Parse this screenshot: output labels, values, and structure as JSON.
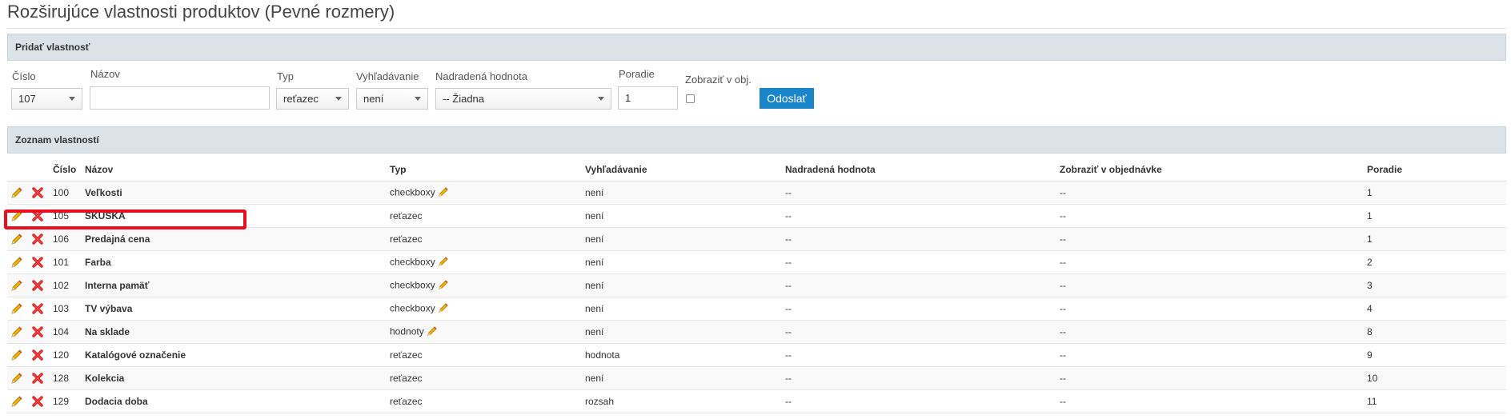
{
  "page": {
    "title": "Rozširujúce vlastnosti produktov (Pevné rozmery)"
  },
  "add_panel": {
    "heading": "Pridať vlastnosť",
    "labels": {
      "cislo": "Číslo",
      "nazov": "Názov",
      "typ": "Typ",
      "vyhladavanie": "Vyhľadávanie",
      "nadradena": "Nadradená hodnota",
      "poradie": "Poradie",
      "zobrazit": "Zobraziť v obj."
    },
    "values": {
      "cislo": "107",
      "nazov": "",
      "typ": "reťazec",
      "vyhladavanie": "není",
      "nadradena": "-- Žiadna",
      "poradie": "1"
    },
    "submit_label": "Odoslať"
  },
  "list_panel": {
    "heading": "Zoznam vlastností",
    "columns": [
      "Číslo",
      "Názov",
      "Typ",
      "Vyhľadávanie",
      "Nadradená hodnota",
      "Zobraziť v objednávke",
      "Poradie"
    ],
    "rows": [
      {
        "cislo": "100",
        "nazov": "Veľkosti",
        "typ": "checkboxy",
        "typ_link": true,
        "vyhladavanie": "není",
        "nadradena": "--",
        "zobrazit": "--",
        "poradie": "1",
        "poradie_link": true
      },
      {
        "cislo": "105",
        "nazov": "SKUSKA",
        "typ": "reťazec",
        "typ_link": false,
        "vyhladavanie": "není",
        "nadradena": "--",
        "zobrazit": "--",
        "poradie": "1",
        "poradie_link": false
      },
      {
        "cislo": "106",
        "nazov": "Predajná cena",
        "typ": "reťazec",
        "typ_link": false,
        "vyhladavanie": "není",
        "nadradena": "--",
        "zobrazit": "--",
        "poradie": "1",
        "poradie_link": true
      },
      {
        "cislo": "101",
        "nazov": "Farba",
        "typ": "checkboxy",
        "typ_link": true,
        "vyhladavanie": "není",
        "nadradena": "--",
        "zobrazit": "--",
        "poradie": "2",
        "poradie_link": false
      },
      {
        "cislo": "102",
        "nazov": "Interna pamäť",
        "typ": "checkboxy",
        "typ_link": true,
        "vyhladavanie": "není",
        "nadradena": "--",
        "zobrazit": "--",
        "poradie": "3",
        "poradie_link": false
      },
      {
        "cislo": "103",
        "nazov": "TV výbava",
        "typ": "checkboxy",
        "typ_link": true,
        "vyhladavanie": "není",
        "nadradena": "--",
        "zobrazit": "--",
        "poradie": "4",
        "poradie_link": false
      },
      {
        "cislo": "104",
        "nazov": "Na sklade",
        "typ": "hodnoty",
        "typ_link": true,
        "vyhladavanie": "není",
        "nadradena": "--",
        "zobrazit": "--",
        "poradie": "8",
        "poradie_link": false
      },
      {
        "cislo": "120",
        "nazov": "Katalógové označenie",
        "typ": "reťazec",
        "typ_link": false,
        "vyhladavanie": "hodnota",
        "nadradena": "--",
        "zobrazit": "--",
        "poradie": "9",
        "poradie_link": false
      },
      {
        "cislo": "128",
        "nazov": "Kolekcia",
        "typ": "reťazec",
        "typ_link": false,
        "vyhladavanie": "není",
        "nadradena": "--",
        "zobrazit": "--",
        "poradie": "10",
        "poradie_link": false
      },
      {
        "cislo": "129",
        "nazov": "Dodacia doba",
        "typ": "reťazec",
        "typ_link": false,
        "vyhladavanie": "rozsah",
        "nadradena": "--",
        "zobrazit": "--",
        "poradie": "11",
        "poradie_link": false
      }
    ],
    "row_icons": [
      "pencil-icon",
      "delete-x-icon"
    ],
    "highlighted_row": "105"
  },
  "colors": {
    "link": "#1b75bb",
    "button": "#1a85c9",
    "highlight": "#e8101f",
    "panel": "#dce3e8"
  }
}
